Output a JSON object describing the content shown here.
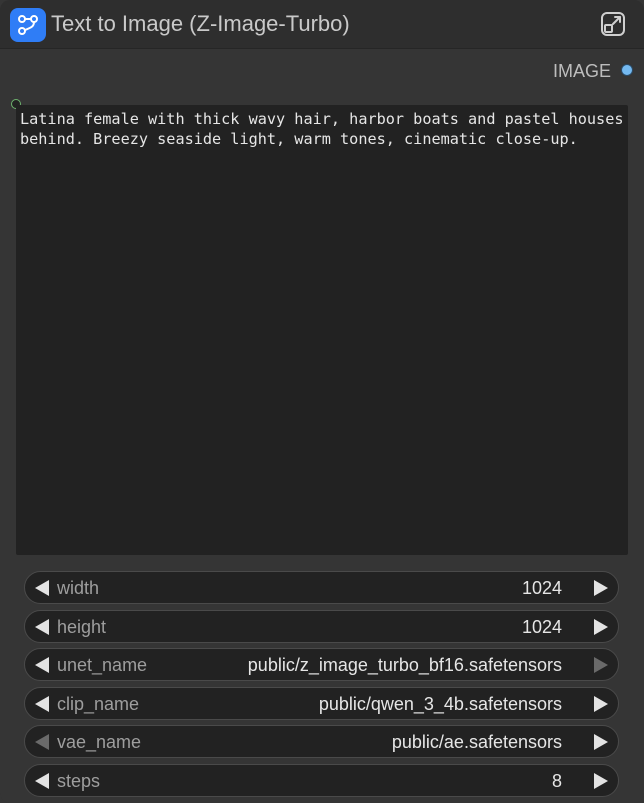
{
  "node": {
    "title": "Text to Image (Z-Image-Turbo)",
    "icon": "subgraph-icon",
    "expand_icon": "expand-icon",
    "accent": "#2f7df6"
  },
  "outputs": [
    {
      "label": "IMAGE",
      "color": "#74b9f0"
    }
  ],
  "prompt": {
    "text": "Latina female with thick wavy hair, harbor boats and pastel houses behind. Breezy seaside light, warm tones, cinematic close-up."
  },
  "widgets": [
    {
      "name": "width",
      "value": "1024",
      "left_enabled": true,
      "right_enabled": true
    },
    {
      "name": "height",
      "value": "1024",
      "left_enabled": true,
      "right_enabled": true
    },
    {
      "name": "unet_name",
      "value": "public/z_image_turbo_bf16.safetensors",
      "left_enabled": true,
      "right_enabled": false
    },
    {
      "name": "clip_name",
      "value": "public/qwen_3_4b.safetensors",
      "left_enabled": true,
      "right_enabled": true
    },
    {
      "name": "vae_name",
      "value": "public/ae.safetensors",
      "left_enabled": false,
      "right_enabled": true
    },
    {
      "name": "steps",
      "value": "8",
      "left_enabled": true,
      "right_enabled": true
    }
  ]
}
